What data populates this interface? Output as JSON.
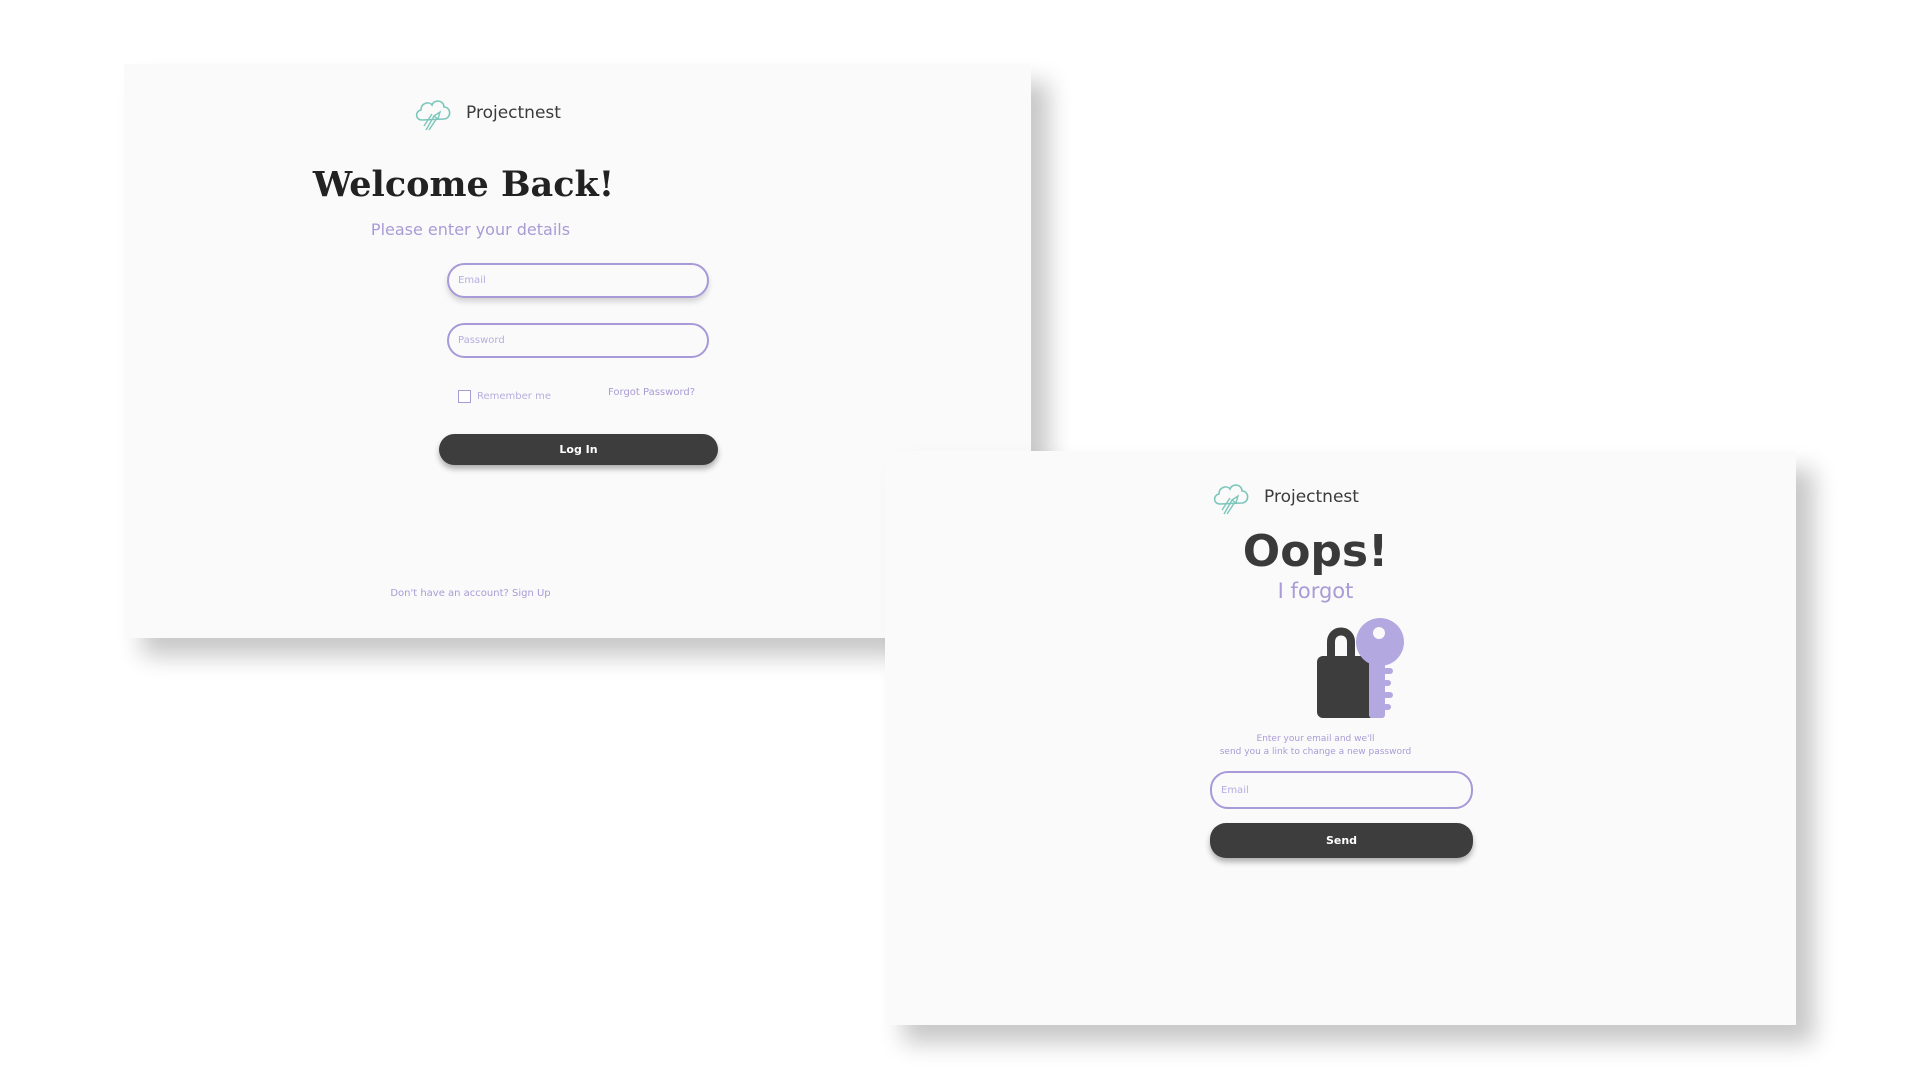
{
  "login": {
    "brand": "Projectnest",
    "title": "Welcome Back!",
    "subtitle": "Please enter your details",
    "email_placeholder": "Email",
    "password_placeholder": "Password",
    "remember_label": "Remember me",
    "forgot_link": "Forgot Password?",
    "login_button": "Log In",
    "signup_text": "Don't have an account? Sign Up"
  },
  "forgot": {
    "brand": "Projectnest",
    "title": "Oops!",
    "subtitle": "I forgot",
    "instructions_line1": "Enter your email and we'll",
    "instructions_line2": "send you a link to change a new password",
    "email_placeholder": "Email",
    "send_button": "Send"
  },
  "colors": {
    "accent_purple": "#a899d8",
    "dark_button": "#3d3d3d",
    "logo_teal": "#7cc6bb",
    "card_bg": "#fafafa"
  },
  "icons": {
    "logo": "cloud-rocket-icon",
    "lock_key": "padlock-key-icon"
  }
}
